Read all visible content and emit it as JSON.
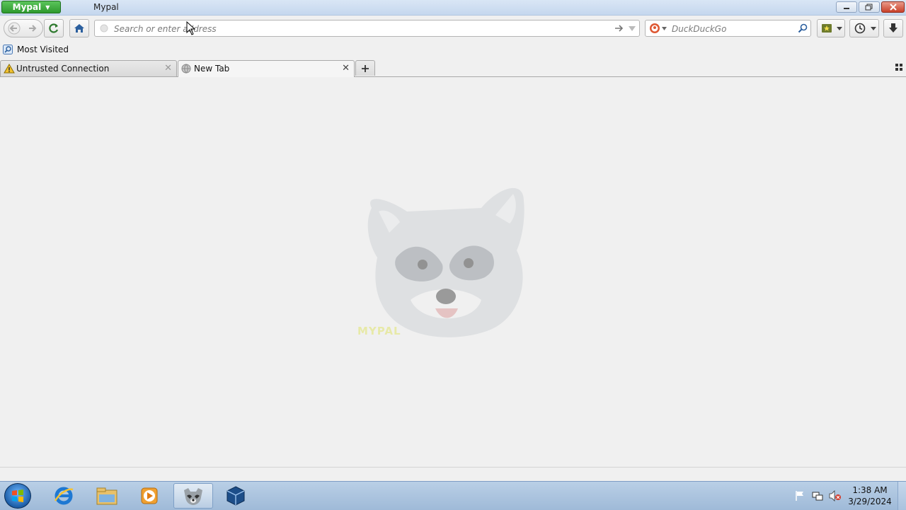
{
  "window": {
    "app_menu_label": "Mypal",
    "title": "Mypal",
    "controls": [
      "minimize",
      "maximize",
      "close"
    ]
  },
  "navbar": {
    "back_icon": "back-arrow-icon",
    "forward_icon": "forward-arrow-icon",
    "reload_icon": "reload-icon",
    "home_icon": "home-icon",
    "url": {
      "value": "",
      "placeholder": "Search or enter address"
    },
    "search": {
      "engine": "DuckDuckGo",
      "placeholder": "DuckDuckGo",
      "value": ""
    },
    "bookmarks_icon": "bookmarks-star-icon",
    "history_icon": "history-clock-icon",
    "downloads_icon": "download-arrow-icon"
  },
  "bookmarks_bar": {
    "items": [
      {
        "label": "Most Visited",
        "icon": "most-visited-icon"
      }
    ]
  },
  "tabs": [
    {
      "label": "Untrusted Connection",
      "icon": "warning-icon",
      "active": false
    },
    {
      "label": "New Tab",
      "icon": "globe-icon",
      "active": true
    }
  ],
  "content": {
    "watermark_text": "MYPAL"
  },
  "taskbar": {
    "pinned": [
      "start-orb",
      "internet-explorer-icon",
      "file-explorer-icon",
      "media-player-icon",
      "mypal-raccoon-icon",
      "virtualbox-icon"
    ],
    "active_item": "mypal-raccoon-icon",
    "clock_time": "1:38 AM",
    "clock_date": "3/29/2024"
  },
  "colors": {
    "app_menu_green": "#2e9a2e",
    "titlebar_blue": "#c5d7ee",
    "taskbar_blue": "#9fbad8",
    "close_red": "#c9412a",
    "content_bg": "#f0f0f0"
  }
}
